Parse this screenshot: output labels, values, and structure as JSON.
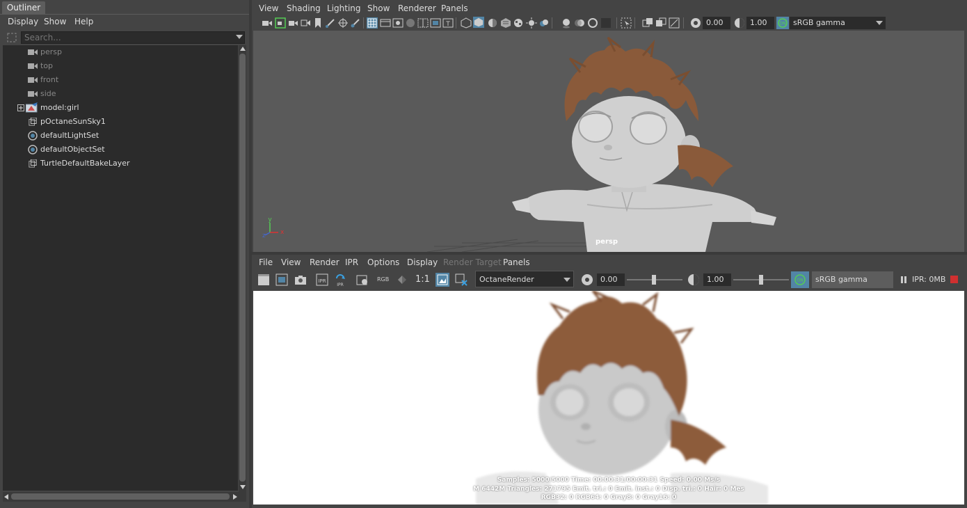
{
  "outliner": {
    "tab_label": "Outliner",
    "menu": [
      "Display",
      "Show",
      "Help"
    ],
    "search_placeholder": "Search...",
    "items": [
      {
        "label": "persp",
        "icon": "camera-icon",
        "dim": true
      },
      {
        "label": "top",
        "icon": "camera-icon",
        "dim": true
      },
      {
        "label": "front",
        "icon": "camera-icon",
        "dim": true
      },
      {
        "label": "side",
        "icon": "camera-icon",
        "dim": true
      },
      {
        "label": "model:girl",
        "icon": "model-group-icon",
        "dim": false,
        "expandable": true
      },
      {
        "label": "pOctaneSunSky1",
        "icon": "sunsky-node-icon",
        "dim": false
      },
      {
        "label": "defaultLightSet",
        "icon": "set-icon",
        "dim": false
      },
      {
        "label": "defaultObjectSet",
        "icon": "set-icon",
        "dim": false
      },
      {
        "label": "TurtleDefaultBakeLayer",
        "icon": "bake-layer-icon",
        "dim": false
      }
    ]
  },
  "viewport": {
    "menu": [
      "View",
      "Shading",
      "Lighting",
      "Show",
      "Renderer",
      "Panels"
    ],
    "exposure_value": "0.00",
    "gamma_value": "1.00",
    "color_space": "sRGB gamma",
    "camera_label": "persp",
    "axis_labels": {
      "x": "x",
      "y": "y",
      "z": "z"
    }
  },
  "render_view": {
    "menu": [
      "File",
      "View",
      "Render",
      "IPR",
      "Options",
      "Display",
      "Render Target",
      "Panels"
    ],
    "disabled_menu": "Render Target",
    "one_to_one": "1:1",
    "rgb_label": "RGB",
    "renderer": "OctaneRender",
    "exposure_value": "0.00",
    "gamma_value": "1.00",
    "color_space": "sRGB gamma",
    "ipr_status": "IPR: 0MB",
    "stats": [
      "Samples: 5000/5000 Time: 00:00:31/00:00:31 Speed: 0.00 Ms/s",
      "M 6442M Triangles: 271795 Emit. tri.: 0 Emit. inst.: 0 Disp. tri.: 0 Hair: 0 Mes",
      "RGB32: 0 RGB64: 0 Gray8: 0 Gray16: 0"
    ]
  },
  "colors": {
    "panel_bg": "#444444",
    "field_bg": "#2b2b2b",
    "viewport_bg": "#5a5a5a",
    "accent": "#5285a6",
    "hair": "#8a5a3a",
    "stop_red": "#d03030"
  }
}
